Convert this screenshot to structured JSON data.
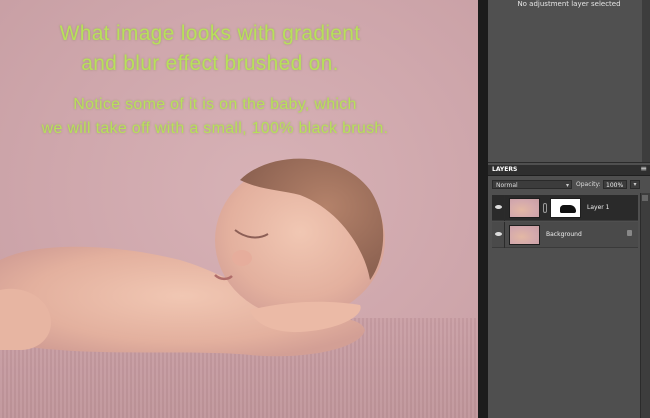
{
  "canvas": {
    "overlay_text": [
      "What image looks with gradient",
      "and blur effect brushed on.",
      "Notice some of it is on the baby, which",
      "we will take off with a small, 100% black brush."
    ],
    "text_color": "#b7e05a"
  },
  "adjustments": {
    "message": "No adjustment layer selected"
  },
  "layers_panel": {
    "tab_label": "LAYERS",
    "menu_icon": "panel-menu-icon",
    "blend_mode": "Normal",
    "opacity_label": "Opacity:",
    "opacity_value": "100%",
    "layers": [
      {
        "name": "Layer 1",
        "selected": true,
        "has_mask": true
      },
      {
        "name": "Background",
        "selected": false,
        "locked": true
      }
    ]
  }
}
